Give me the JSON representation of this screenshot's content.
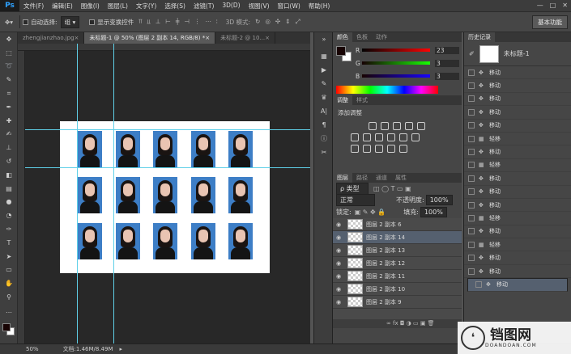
{
  "menubar": {
    "logo": "Ps",
    "items": [
      "文件(F)",
      "编辑(E)",
      "图像(I)",
      "图层(L)",
      "文字(Y)",
      "选择(S)",
      "滤镜(T)",
      "3D(D)",
      "视图(V)",
      "窗口(W)",
      "帮助(H)"
    ],
    "min": "—",
    "max": "□",
    "close": "✕"
  },
  "options": {
    "auto_select_label": "自动选择:",
    "auto_select_value": "组",
    "show_transform_label": "显示变换控件",
    "mode3d_label": "3D 模式:",
    "workspace": "基本功能"
  },
  "tabs": [
    {
      "label": "zhengjianzhao.jpg"
    },
    {
      "label": "未标题-1 @ 50% (图层 2 副本 14, RGB/8) *"
    },
    {
      "label": "未标题-2 @ 10..."
    }
  ],
  "status": {
    "zoom": "50%",
    "doc": "文档:1.46M/8.49M"
  },
  "color_panel": {
    "tabs": [
      "颜色",
      "色板",
      "动作"
    ],
    "r_label": "R",
    "r_value": "23",
    "g_label": "G",
    "g_value": "3",
    "b_label": "B",
    "b_value": "3"
  },
  "adjust_panel": {
    "tabs": [
      "调整",
      "样式"
    ],
    "title": "添加调整"
  },
  "layers_panel": {
    "tabs": [
      "图层",
      "路径",
      "通道",
      "属性"
    ],
    "kind": "ρ 类型",
    "blend": "正常",
    "opacity_label": "不透明度:",
    "opacity_value": "100%",
    "lock_label": "锁定:",
    "fill_label": "填充:",
    "fill_value": "100%",
    "layers": [
      {
        "name": "图层 2 副本 6",
        "selected": false
      },
      {
        "name": "图层 2 副本 14",
        "selected": true
      },
      {
        "name": "图层 2 副本 13",
        "selected": false
      },
      {
        "name": "图层 2 副本 12",
        "selected": false
      },
      {
        "name": "图层 2 副本 11",
        "selected": false
      },
      {
        "name": "图层 2 副本 10",
        "selected": false
      },
      {
        "name": "图层 2 副本 9",
        "selected": false
      }
    ],
    "footer": "∞  fx  ◘  ◑  ▭  ▣  🗑"
  },
  "history_panel": {
    "title": "历史记录",
    "snapshot": "未标题-1",
    "items": [
      "移动",
      "移动",
      "移动",
      "移动",
      "移动",
      "轻移",
      "移动",
      "轻移",
      "移动",
      "移动",
      "移动",
      "轻移",
      "移动",
      "轻移",
      "移动",
      "移动",
      "移动"
    ]
  },
  "watermark": {
    "name": "铛图网",
    "sub": "DOANDOAN.COM"
  },
  "colors": {
    "guide": "#5fd0e8",
    "photo_bg": "#3d7ec6",
    "selected_row": "#55606f"
  }
}
